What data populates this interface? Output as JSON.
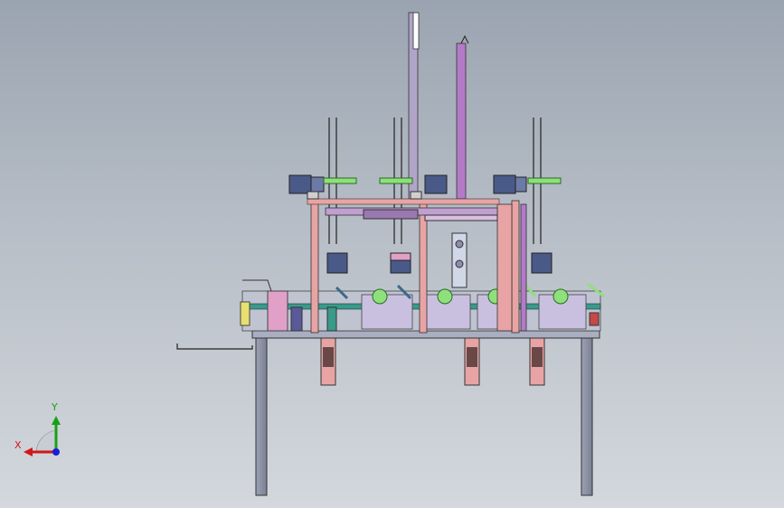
{
  "viewport": {
    "background_top": "#9aa4b0",
    "background_bottom": "#d4d8dd"
  },
  "triad": {
    "x_label": "X",
    "y_label": "Y",
    "x_color": "#d01818",
    "y_color": "#18a018",
    "z_color": "#1820d0"
  },
  "model": {
    "frame_color": "#8f96a6",
    "table_color": "#a9aec0",
    "pink_color": "#e8a4a4",
    "green_color": "#8fe07a",
    "navy_color": "#4a5a88",
    "magenta_color": "#b47ac8",
    "teal_color": "#3a9a8a"
  }
}
